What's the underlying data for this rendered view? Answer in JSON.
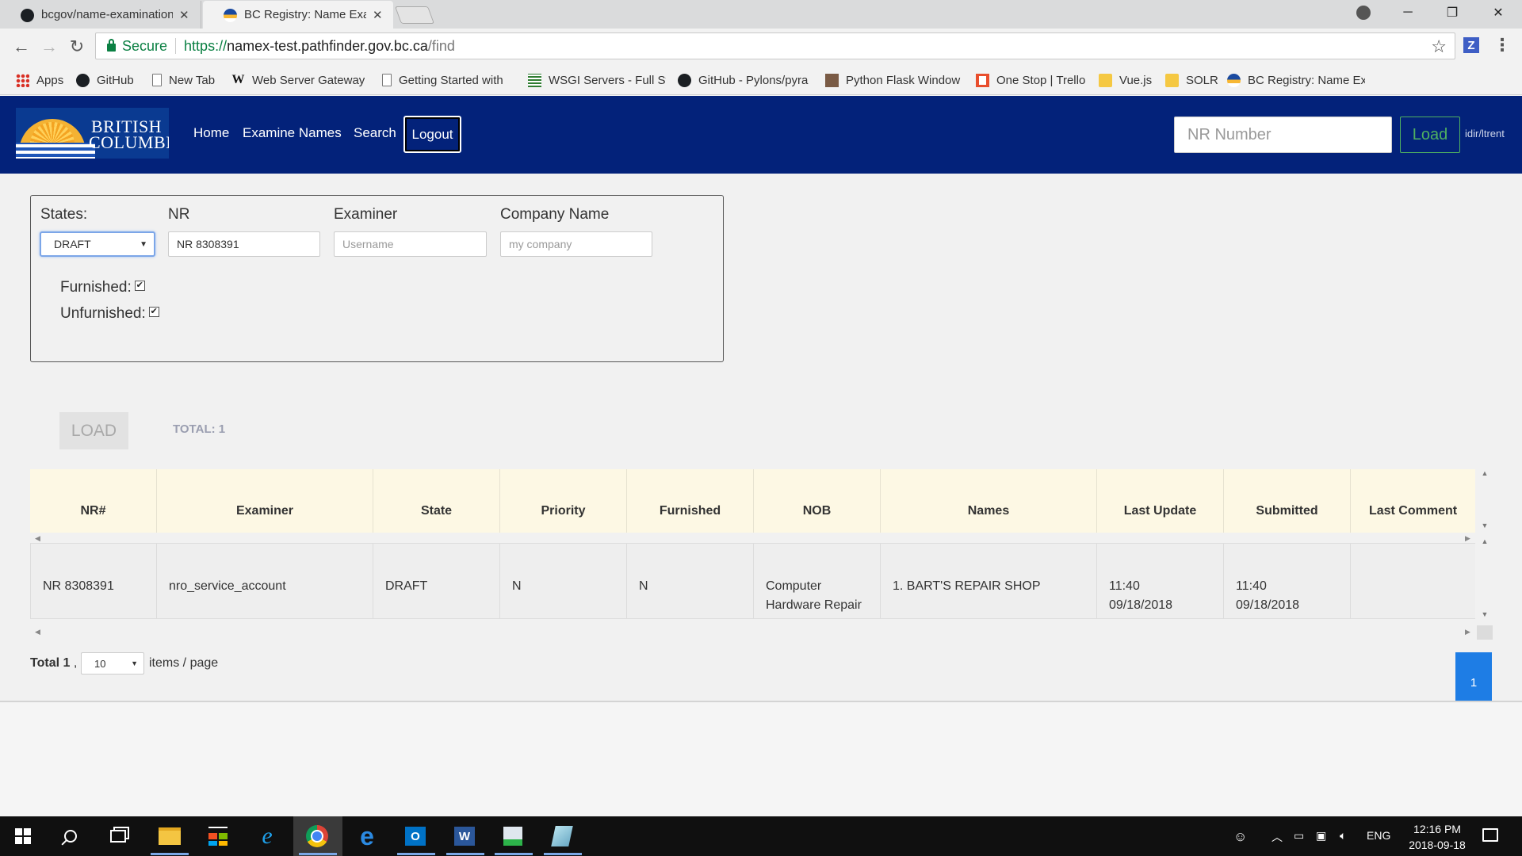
{
  "browser": {
    "tabs": [
      {
        "title": "bcgov/name-examination",
        "close": "✕"
      },
      {
        "title": "BC Registry: Name Examination",
        "close": "✕"
      }
    ],
    "window_controls": {
      "minimize": "─",
      "restore": "❐",
      "close": "✕"
    },
    "address": {
      "secure_label": "Secure",
      "url_scheme": "https://",
      "url_host": "namex-test.pathfinder.gov.bc.ca",
      "url_path": "/find"
    },
    "extension_label": "Z",
    "bookmarks": [
      {
        "label": "Apps",
        "icon": "apps-grid-icon"
      },
      {
        "label": "GitHub",
        "icon": "github-icon"
      },
      {
        "label": "New Tab",
        "icon": "page-icon"
      },
      {
        "label": "Web Server Gateway",
        "icon": "wikipedia-icon"
      },
      {
        "label": "Getting Started with",
        "icon": "page-icon"
      },
      {
        "label": "WSGI Servers - Full St",
        "icon": "grid-icon"
      },
      {
        "label": "GitHub - Pylons/pyra",
        "icon": "github-icon"
      },
      {
        "label": "Python Flask Window",
        "icon": "photo-icon"
      },
      {
        "label": "One Stop | Trello",
        "icon": "trello-icon"
      },
      {
        "label": "Vue.js",
        "icon": "folder-icon"
      },
      {
        "label": "SOLR",
        "icon": "folder-icon"
      },
      {
        "label": "BC Registry: Name Ex",
        "icon": "bc-icon"
      }
    ]
  },
  "header": {
    "logo_line1": "BRITISH",
    "logo_line2": "COLUMBIA",
    "nav": {
      "home": "Home",
      "examine": "Examine Names",
      "search": "Search",
      "logout": "Logout"
    },
    "nr_placeholder": "NR Number",
    "load": "Load",
    "user": "idir/ltrent"
  },
  "filters": {
    "states_label": "States:",
    "states_value": "DRAFT",
    "nr_label": "NR",
    "nr_value": "NR 8308391",
    "examiner_label": "Examiner",
    "examiner_placeholder": "Username",
    "company_label": "Company Name",
    "company_placeholder": "my company",
    "furnished_label": "Furnished:",
    "furnished_checked": true,
    "unfurnished_label": "Unfurnished:",
    "unfurnished_checked": true
  },
  "actions": {
    "load": "LOAD",
    "total": "TOTAL: 1"
  },
  "table": {
    "columns": [
      "NR#",
      "Examiner",
      "State",
      "Priority",
      "Furnished",
      "NOB",
      "Names",
      "Last Update",
      "Submitted",
      "Last Comment"
    ],
    "rows": [
      {
        "nr": "NR 8308391",
        "examiner": "nro_service_account",
        "state": "DRAFT",
        "priority": "N",
        "furnished": "N",
        "nob_line1": "Computer",
        "nob_line2": "Hardware Repair",
        "names": "1. BART'S REPAIR SHOP",
        "last_update_time": "11:40",
        "last_update_date": "09/18/2018",
        "submitted_time": "11:40",
        "submitted_date": "09/18/2018",
        "last_comment": ""
      }
    ]
  },
  "pagination": {
    "total_prefix": "Total",
    "total_count": "1",
    "total_suffix": ",",
    "page_size": "10",
    "items_per_page": "items / page",
    "current_page": "1"
  },
  "taskbar": {
    "tray_lang": "ENG",
    "clock_time": "12:16 PM",
    "clock_date": "2018-09-18"
  }
}
